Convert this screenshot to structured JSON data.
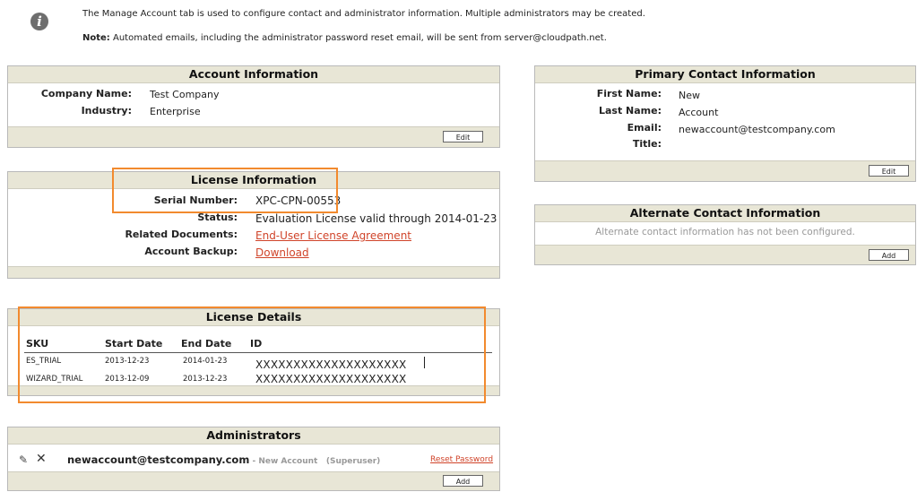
{
  "intro": {
    "line1": "The Manage Account tab is used to configure contact and administrator information. Multiple administrators may be created.",
    "note_label": "Note:",
    "note_text": " Automated emails, including the administrator password reset email, will be sent from server@cloudpath.net."
  },
  "account": {
    "title": "Account Information",
    "company_label": "Company Name:",
    "company_value": "Test Company",
    "industry_label": "Industry:",
    "industry_value": "Enterprise",
    "edit_label": "Edit"
  },
  "license": {
    "title": "License Information",
    "serial_label": "Serial Number:",
    "serial_value": "XPC-CPN-00553",
    "status_label": "Status:",
    "status_value": "Evaluation License valid through 2014-01-23",
    "docs_label": "Related Documents:",
    "docs_link": "End-User License Agreement",
    "backup_label": "Account Backup:",
    "backup_link": "Download"
  },
  "details": {
    "title": "License Details",
    "columns": [
      "SKU",
      "Start Date",
      "End Date",
      "ID"
    ],
    "rows": [
      [
        "ES_TRIAL",
        "2013-12-23",
        "2014-01-23",
        "XXXXXXXXXXXXXXXXXXXX"
      ],
      [
        "WIZARD_TRIAL",
        "2013-12-09",
        "2013-12-23",
        "XXXXXXXXXXXXXXXXXXXX"
      ]
    ]
  },
  "admins": {
    "title": "Administrators",
    "email": "newaccount@testcompany.com",
    "sep": " - ",
    "name": "New Account",
    "role": "(Superuser)",
    "reset_label": "Reset Password",
    "add_label": "Add",
    "edit_icon": "pencil-icon",
    "delete_icon": "x-icon"
  },
  "primary": {
    "title": "Primary Contact Information",
    "first_label": "First Name:",
    "first_value": "New",
    "last_label": "Last Name:",
    "last_value": "Account",
    "email_label": "Email:",
    "email_value": "newaccount@testcompany.com",
    "title_label": "Title:",
    "edit_label": "Edit"
  },
  "alternate": {
    "title": "Alternate Contact Information",
    "message": "Alternate contact information has not been configured.",
    "add_label": "Add"
  },
  "colors": {
    "header_bg": "#e8e6d6",
    "link": "#d0442a",
    "highlight": "#f28a2e"
  }
}
